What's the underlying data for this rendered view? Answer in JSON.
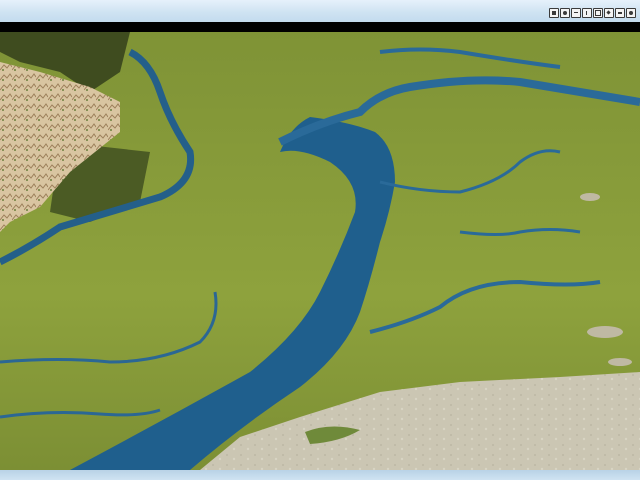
{
  "window": {
    "toolbar_buttons": [
      {
        "icon": "fit-view-icon"
      },
      {
        "icon": "zoom-in-icon"
      },
      {
        "icon": "zoom-out-icon"
      },
      {
        "icon": "pan-icon"
      },
      {
        "icon": "rotate-icon"
      },
      {
        "icon": "grid-icon"
      },
      {
        "icon": "reset-view-icon"
      },
      {
        "icon": "close-view-icon"
      }
    ]
  },
  "scene": {
    "type": "3d-terrain-view",
    "colors": {
      "water": "#1d5f8e",
      "grassland": "#8a9b3a",
      "hills": "#d8c4a0",
      "forest": "#4a5a24",
      "sand": "#c9c4b0"
    }
  }
}
